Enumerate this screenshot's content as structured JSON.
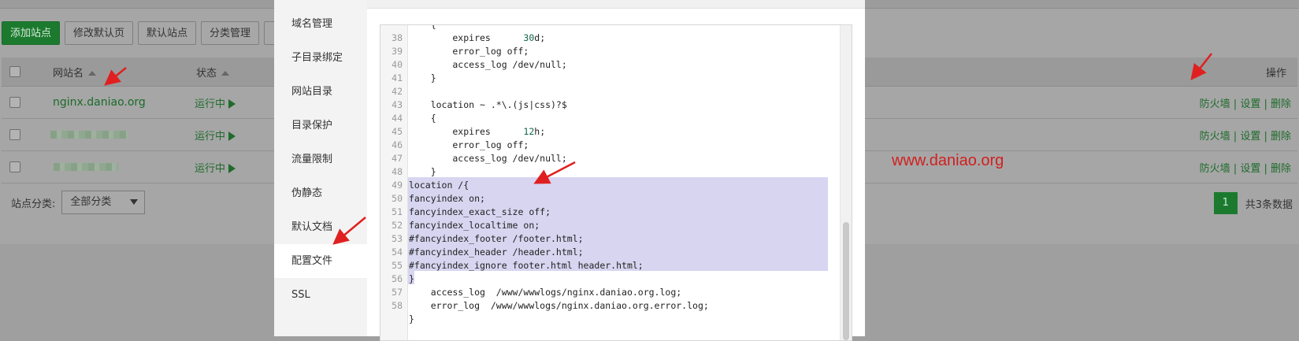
{
  "toolbar": {
    "add_site": "添加站点",
    "modify_default_page": "修改默认页",
    "default_site": "默认站点",
    "category_manage": "分类管理"
  },
  "table": {
    "headers": {
      "name": "网站名",
      "status": "状态",
      "ops": "操作"
    },
    "rows": [
      {
        "name": "nginx.daniao.org",
        "status": "运行中",
        "firewall": "防火墙",
        "settings": "设置",
        "delete": "删除"
      },
      {
        "name": "",
        "status": "运行中",
        "firewall": "防火墙",
        "settings": "设置",
        "delete": "删除"
      },
      {
        "name": "",
        "status": "运行中",
        "firewall": "防火墙",
        "settings": "设置",
        "delete": "删除"
      }
    ]
  },
  "filter": {
    "label": "站点分类:",
    "selected": "全部分类"
  },
  "pagination": {
    "current": "1",
    "total": "共3条数据"
  },
  "watermark": "www.daniao.org",
  "menu": {
    "items": [
      "域名管理",
      "子目录绑定",
      "网站目录",
      "目录保护",
      "流量限制",
      "伪静态",
      "默认文档",
      "配置文件",
      "SSL"
    ],
    "active": "配置文件"
  },
  "editor": {
    "lines": [
      {
        "n": "",
        "t": "    {"
      },
      {
        "n": "38",
        "t": "        expires      30d;"
      },
      {
        "n": "39",
        "t": "        error_log off;"
      },
      {
        "n": "40",
        "t": "        access_log /dev/null;"
      },
      {
        "n": "41",
        "t": "    }"
      },
      {
        "n": "42",
        "t": ""
      },
      {
        "n": "43",
        "t": "    location ~ .*\\.(js|css)?$"
      },
      {
        "n": "44",
        "t": "    {"
      },
      {
        "n": "45",
        "t": "        expires      12h;"
      },
      {
        "n": "46",
        "t": "        error_log off;"
      },
      {
        "n": "47",
        "t": "        access_log /dev/null;"
      },
      {
        "n": "48",
        "t": "    }"
      },
      {
        "n": "49",
        "t": "location /{"
      },
      {
        "n": "50",
        "t": "fancyindex on;"
      },
      {
        "n": "51",
        "t": "fancyindex_exact_size off;"
      },
      {
        "n": "52",
        "t": "fancyindex_localtime on;"
      },
      {
        "n": "53",
        "t": "#fancyindex_footer /footer.html;"
      },
      {
        "n": "54",
        "t": "#fancyindex_header /header.html;"
      },
      {
        "n": "55",
        "t": "#fancyindex_ignore footer.html header.html;"
      },
      {
        "n": "56",
        "t": "}"
      },
      {
        "n": "57",
        "t": "    access_log  /www/wwwlogs/nginx.daniao.org.log;"
      },
      {
        "n": "58",
        "t": "    error_log  /www/wwwlogs/nginx.daniao.org.error.log;"
      },
      {
        "n": "",
        "t": "}"
      }
    ]
  },
  "colors": {
    "accent_green": "#20a53a",
    "annotation_red": "#e02020",
    "selection": "#d7d5f0"
  }
}
